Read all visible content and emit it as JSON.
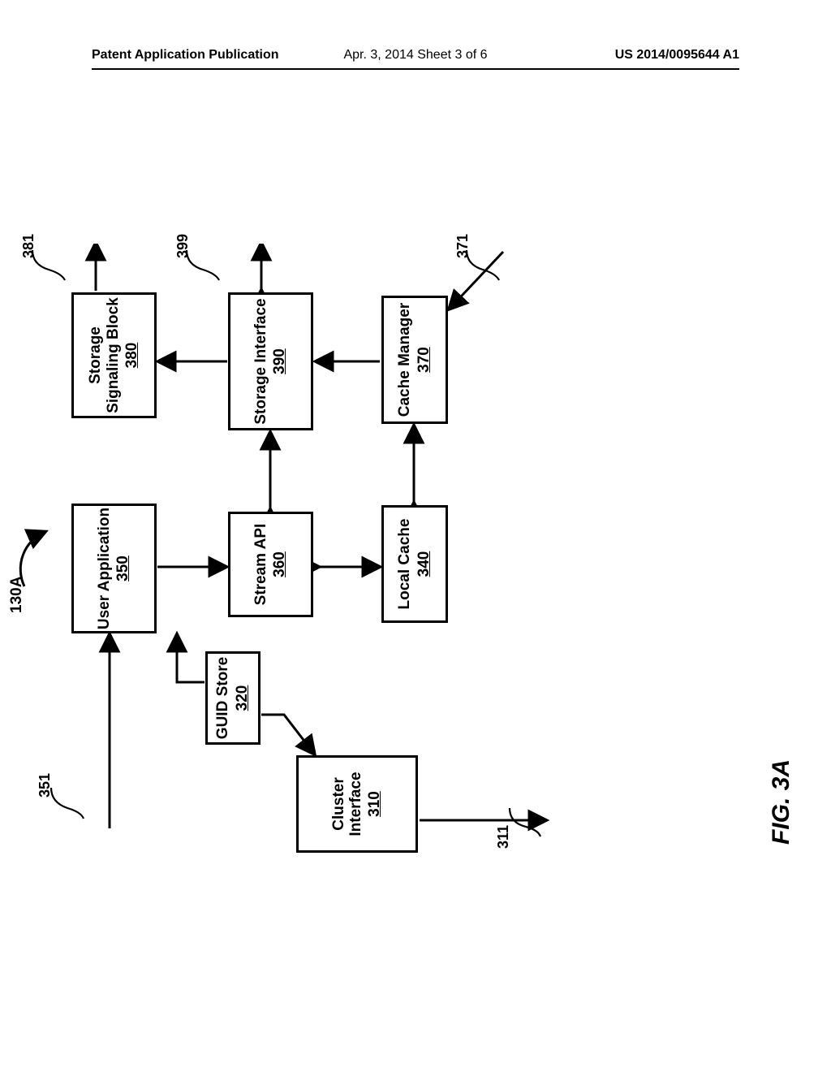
{
  "header": {
    "left": "Patent Application Publication",
    "center": "Apr. 3, 2014   Sheet 3 of 6",
    "right": "US 2014/0095644 A1"
  },
  "figure": {
    "title": "FIG. 3A",
    "overall_ref": "130A"
  },
  "blocks": {
    "userapp": {
      "title": "User Application",
      "num": "350"
    },
    "streamapi": {
      "title": "Stream API",
      "num": "360"
    },
    "localcache": {
      "title": "Local Cache",
      "num": "340"
    },
    "ssb": {
      "title": "Storage Signaling Block",
      "num": "380"
    },
    "sif": {
      "title": "Storage Interface",
      "num": "390"
    },
    "cmgr": {
      "title": "Cache Manager",
      "num": "370"
    },
    "guid": {
      "title": "GUID Store",
      "num": "320"
    },
    "cluster": {
      "title": "Cluster Interface",
      "num": "310"
    }
  },
  "labels": {
    "l351": "351",
    "l311": "311",
    "l381": "381",
    "l399": "399",
    "l371": "371"
  }
}
